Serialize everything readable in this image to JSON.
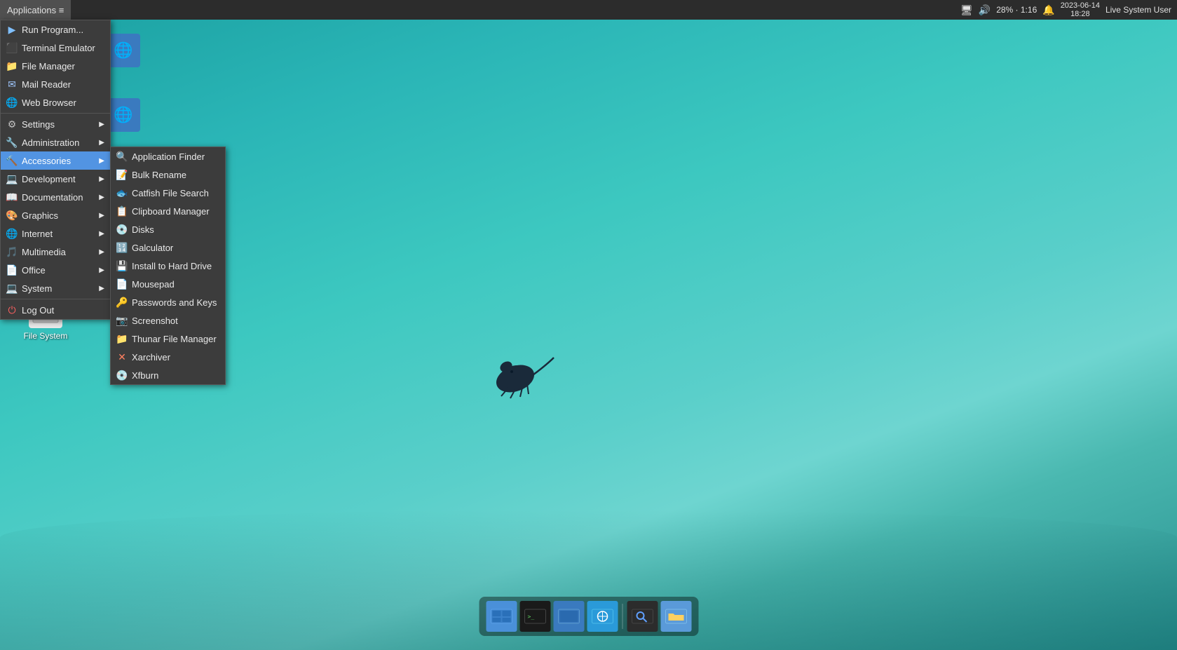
{
  "topPanel": {
    "applicationsLabel": "Applications ≡",
    "battery": "28% · 1:16",
    "datetime": "2023-06-14\n18:28",
    "user": "Live System User"
  },
  "appsMenu": {
    "items": [
      {
        "id": "run-program",
        "label": "Run Program...",
        "icon": "▶",
        "hasSubmenu": false
      },
      {
        "id": "terminal",
        "label": "Terminal Emulator",
        "icon": "⬛",
        "hasSubmenu": false
      },
      {
        "id": "file-manager",
        "label": "File Manager",
        "icon": "📁",
        "hasSubmenu": false
      },
      {
        "id": "mail-reader",
        "label": "Mail Reader",
        "icon": "✉",
        "hasSubmenu": false
      },
      {
        "id": "web-browser",
        "label": "Web Browser",
        "icon": "🌐",
        "hasSubmenu": false
      },
      {
        "id": "settings",
        "label": "Settings",
        "icon": "⚙",
        "hasSubmenu": true
      },
      {
        "id": "administration",
        "label": "Administration",
        "icon": "🔧",
        "hasSubmenu": true
      },
      {
        "id": "accessories",
        "label": "Accessories",
        "icon": "🔨",
        "hasSubmenu": true,
        "active": true
      },
      {
        "id": "development",
        "label": "Development",
        "icon": "💻",
        "hasSubmenu": true
      },
      {
        "id": "documentation",
        "label": "Documentation",
        "icon": "📖",
        "hasSubmenu": true
      },
      {
        "id": "graphics",
        "label": "Graphics",
        "icon": "🎨",
        "hasSubmenu": true
      },
      {
        "id": "internet",
        "label": "Internet",
        "icon": "🌐",
        "hasSubmenu": true
      },
      {
        "id": "multimedia",
        "label": "Multimedia",
        "icon": "🎵",
        "hasSubmenu": true
      },
      {
        "id": "office",
        "label": "Office",
        "icon": "📄",
        "hasSubmenu": true
      },
      {
        "id": "system",
        "label": "System",
        "icon": "💻",
        "hasSubmenu": true
      },
      {
        "id": "log-out",
        "label": "Log Out",
        "icon": "⏻",
        "hasSubmenu": false
      }
    ]
  },
  "accessoriesSubmenu": {
    "items": [
      {
        "id": "app-finder",
        "label": "Application Finder",
        "icon": "🔍"
      },
      {
        "id": "bulk-rename",
        "label": "Bulk Rename",
        "icon": "📝"
      },
      {
        "id": "catfish",
        "label": "Catfish File Search",
        "icon": "🐟"
      },
      {
        "id": "clipboard",
        "label": "Clipboard Manager",
        "icon": "📋"
      },
      {
        "id": "disks",
        "label": "Disks",
        "icon": "💿"
      },
      {
        "id": "calculator",
        "label": "Galculator",
        "icon": "🔢"
      },
      {
        "id": "install",
        "label": "Install to Hard Drive",
        "icon": "💾"
      },
      {
        "id": "mousepad",
        "label": "Mousepad",
        "icon": "📄"
      },
      {
        "id": "passwords",
        "label": "Passwords and Keys",
        "icon": "🔑"
      },
      {
        "id": "screenshot",
        "label": "Screenshot",
        "icon": "📷"
      },
      {
        "id": "thunar",
        "label": "Thunar File Manager",
        "icon": "📁"
      },
      {
        "id": "xarchiver",
        "label": "Xarchiver",
        "icon": "📦"
      },
      {
        "id": "xfburn",
        "label": "Xfburn",
        "icon": "💿"
      }
    ]
  },
  "desktopIcons": [
    {
      "id": "file-system",
      "label": "File System",
      "icon": "🖥"
    }
  ],
  "taskbar": {
    "icons": [
      {
        "id": "workspace1",
        "icon": "⬜",
        "color": "#4a90d9"
      },
      {
        "id": "terminal",
        "icon": ">_",
        "color": "#2c2c2c"
      },
      {
        "id": "workspace2",
        "icon": "⬜",
        "color": "#3a7abf"
      },
      {
        "id": "files",
        "icon": "🌐",
        "color": "#2a9ad9"
      },
      {
        "id": "search",
        "icon": "🔍",
        "color": "#2c2c2c"
      },
      {
        "id": "folder",
        "icon": "📁",
        "color": "#5a9ad9"
      }
    ]
  }
}
